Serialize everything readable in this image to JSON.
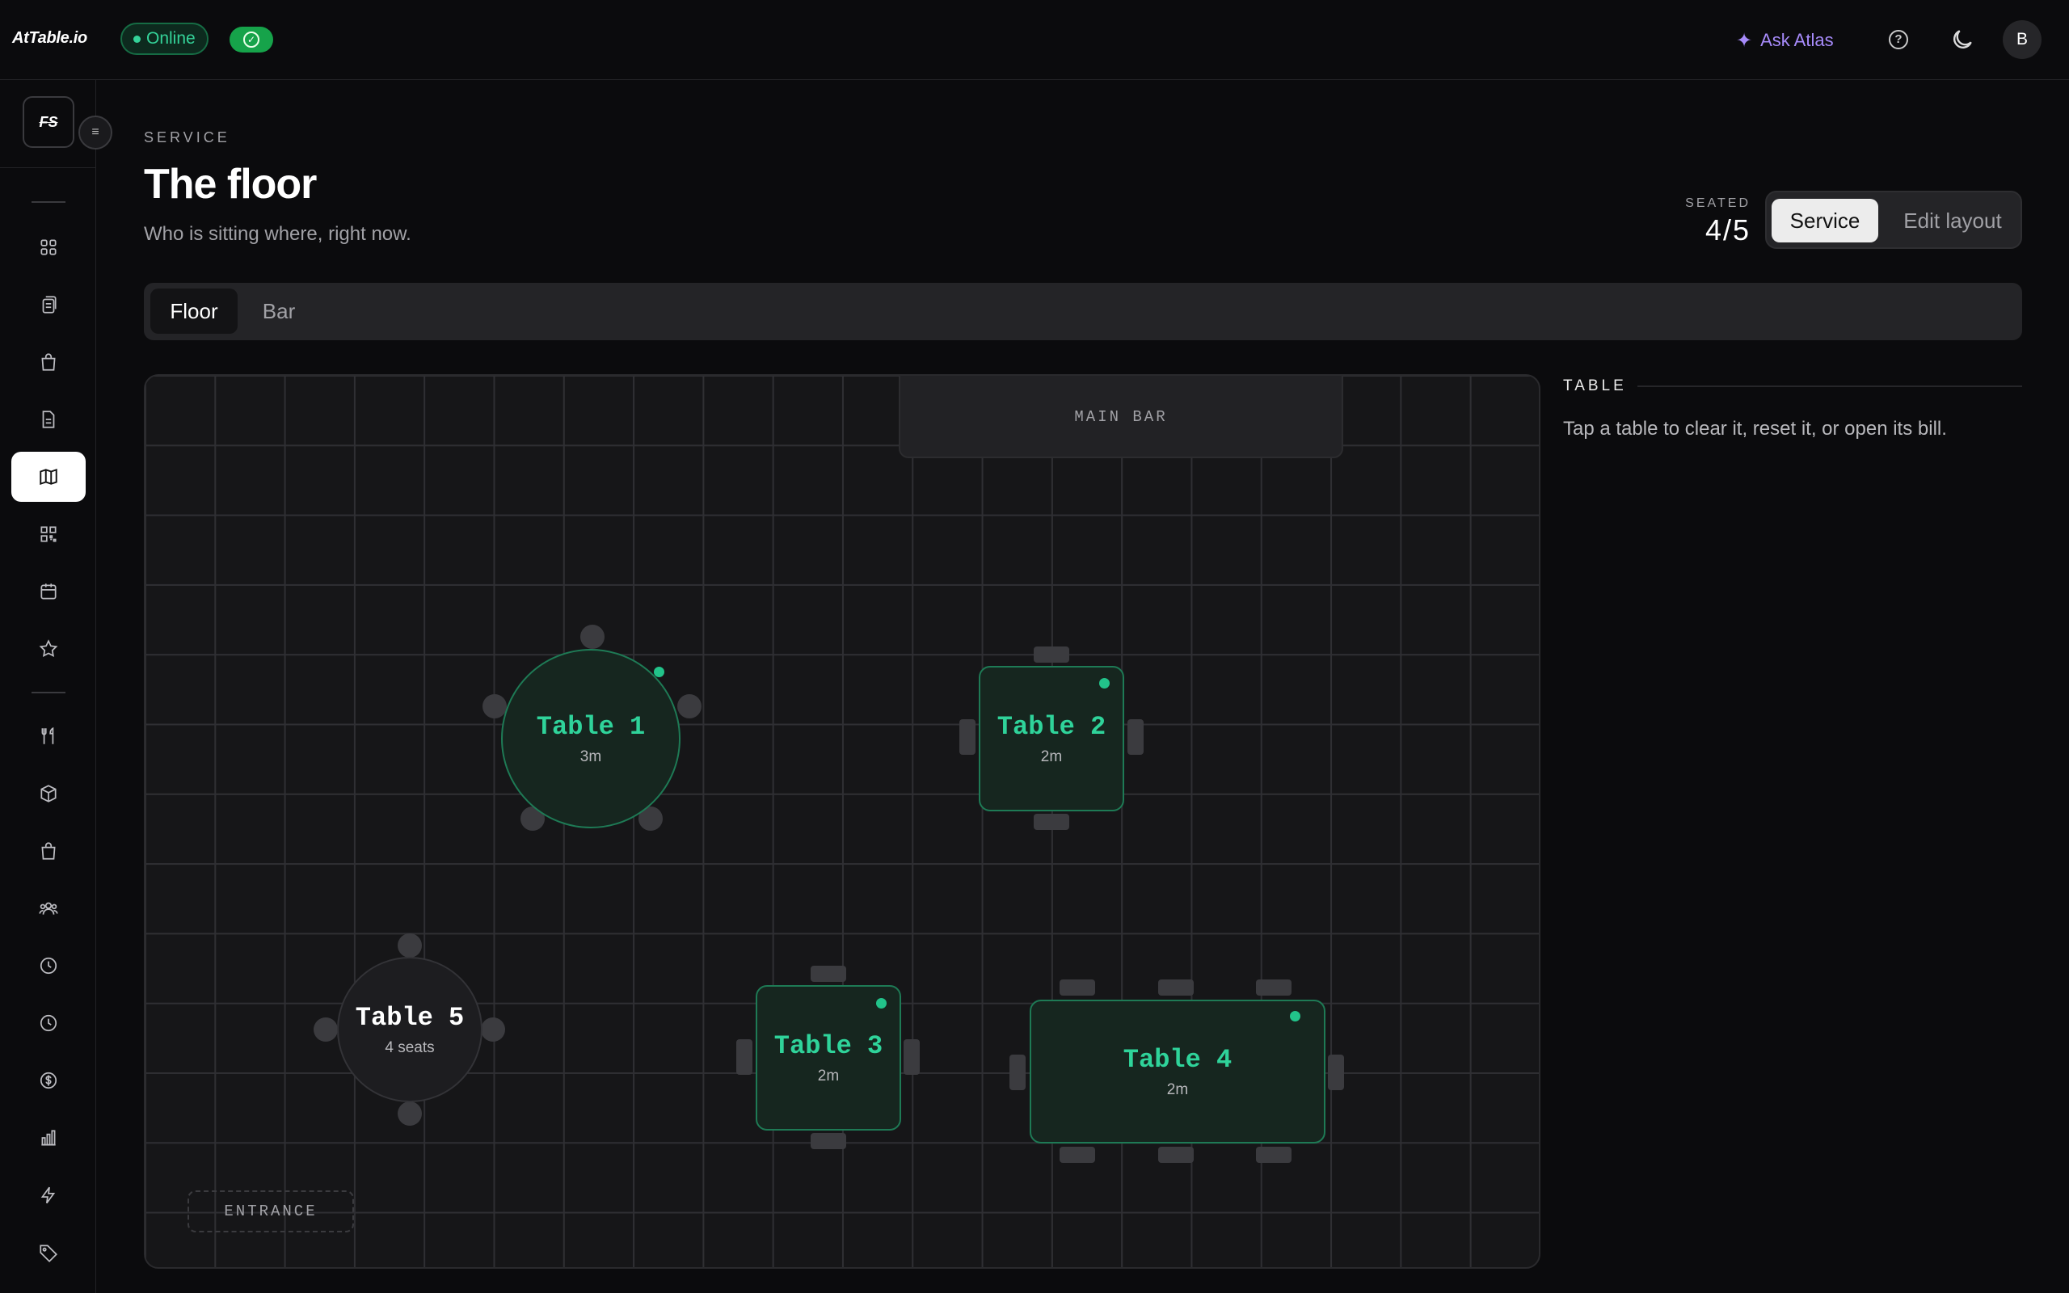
{
  "app": {
    "logo": "AtTable.io"
  },
  "topbar": {
    "status": "Online",
    "ask_label": "Ask Atlas",
    "avatar_initial": "B",
    "icons": [
      "sparkle-icon",
      "help-icon",
      "moon-icon"
    ]
  },
  "sidebar": {
    "brand": "FS",
    "items": [
      "dashboard-icon",
      "orders-icon",
      "shopping-bag-icon",
      "document-icon",
      "map-icon",
      "qr-code-icon",
      "calendar-icon",
      "star-icon",
      "utensils-icon",
      "box-icon",
      "bag-icon",
      "users-icon",
      "clock-icon",
      "history-icon",
      "dollar-icon",
      "chart-icon",
      "lightning-icon",
      "tag-icon"
    ],
    "active_index": 4
  },
  "header": {
    "eyebrow": "SERVICE",
    "title": "The floor",
    "subtitle": "Who is sitting where, right now.",
    "seated_label": "SEATED",
    "seated_value": "4/5",
    "modes": [
      "Service",
      "Edit layout"
    ],
    "active_mode": "Service"
  },
  "tabs": {
    "items": [
      "Floor",
      "Bar"
    ],
    "active": "Floor"
  },
  "floor": {
    "zones": {
      "bar": "MAIN BAR",
      "entrance": "ENTRANCE"
    },
    "tables": [
      {
        "name": "Table 1",
        "sub": "3m",
        "status": "occupied",
        "shape": "round"
      },
      {
        "name": "Table 2",
        "sub": "2m",
        "status": "occupied",
        "shape": "square"
      },
      {
        "name": "Table 3",
        "sub": "2m",
        "status": "occupied",
        "shape": "square"
      },
      {
        "name": "Table 4",
        "sub": "2m",
        "status": "occupied",
        "shape": "rect"
      },
      {
        "name": "Table 5",
        "sub": "4 seats",
        "status": "free",
        "shape": "round"
      }
    ]
  },
  "panel": {
    "heading": "TABLE",
    "hint": "Tap a table to clear it, reset it, or open its bill."
  },
  "colors": {
    "accent": "#2fd39a",
    "online": "#34d399",
    "atlas": "#a78bfa",
    "background": "#0b0b0d"
  }
}
